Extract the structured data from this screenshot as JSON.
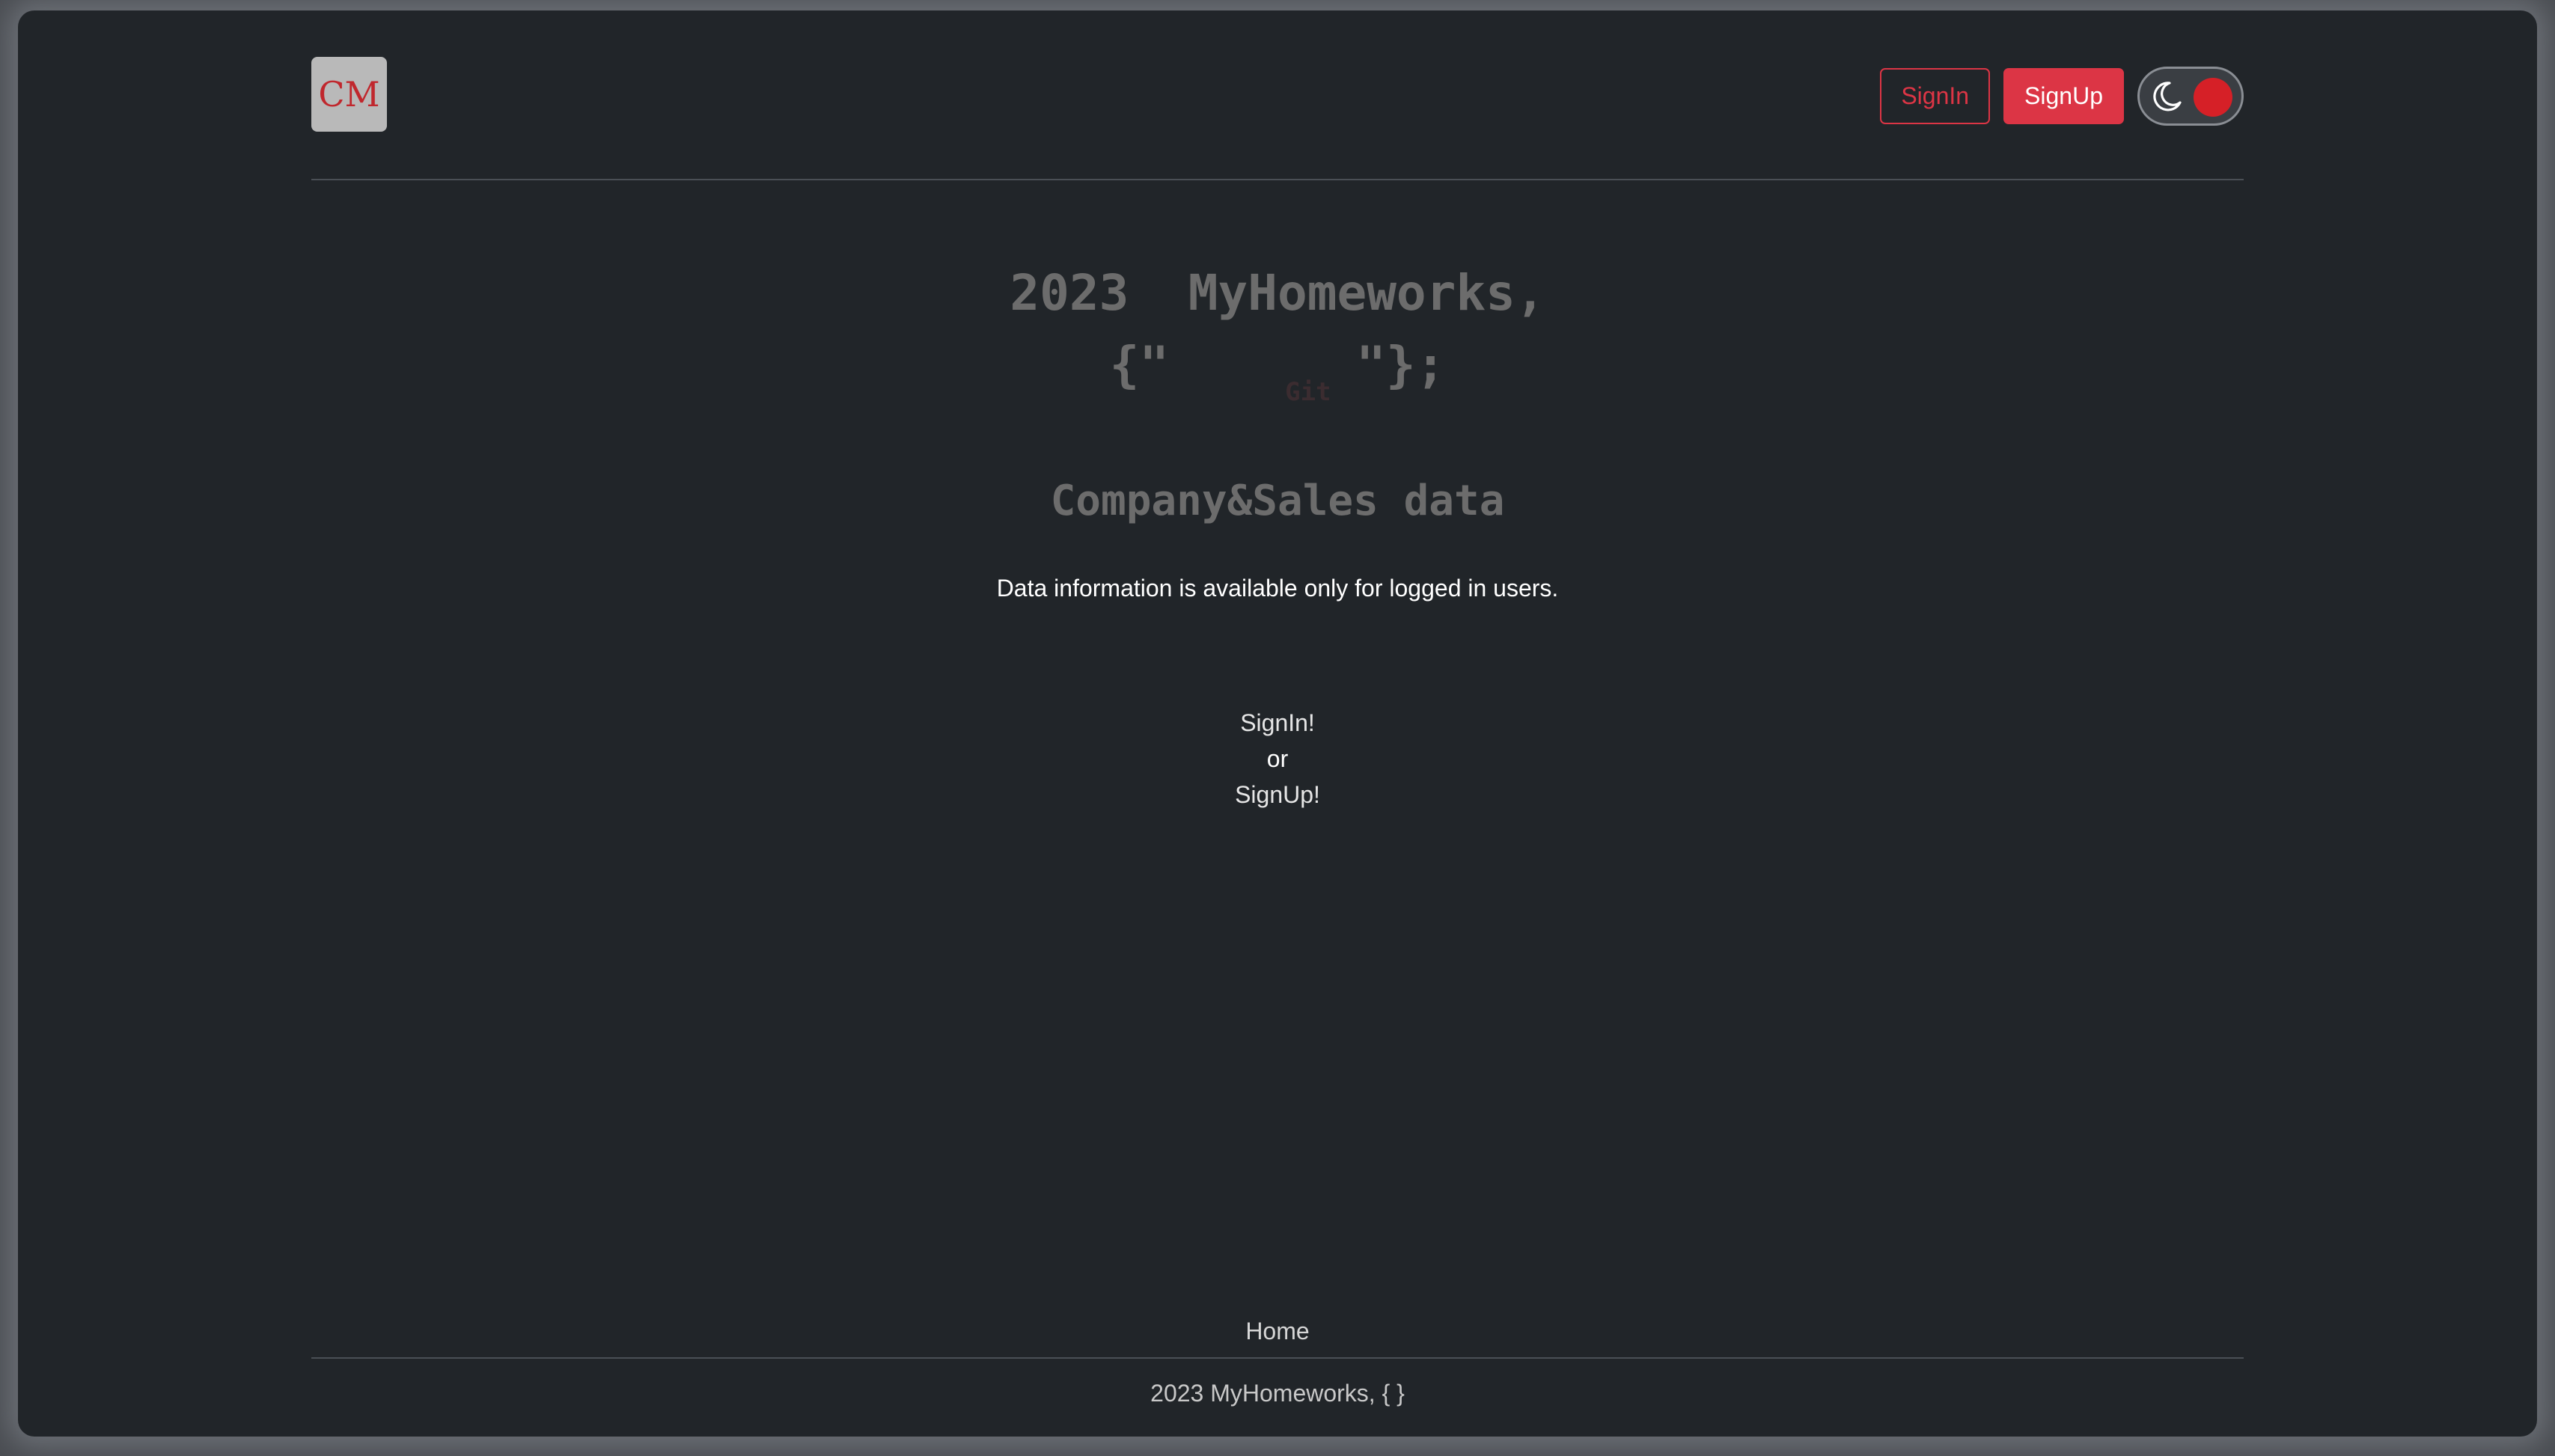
{
  "header": {
    "logo_text": "CM",
    "signin_label": "SignIn",
    "signup_label": "SignUp",
    "theme_toggle": {
      "icon": "moon-icon",
      "state": "dark",
      "knob_color": "#d62027"
    }
  },
  "hero": {
    "line1": "2023  MyHomeworks,",
    "line2_open": "{\"",
    "line2_hidden_word": "Git",
    "line2_close": "\"};"
  },
  "main": {
    "title": "Company&Sales data",
    "info": "Data information is available only for logged in users.",
    "signin_link": "SignIn!",
    "or_text": "or",
    "signup_link": "SignUp!"
  },
  "footer": {
    "home_link": "Home",
    "copyright": "2023 MyHomeworks, { }"
  },
  "colors": {
    "accent": "#dc3545",
    "background": "#212529",
    "muted_heading": "#6c6c6c"
  }
}
